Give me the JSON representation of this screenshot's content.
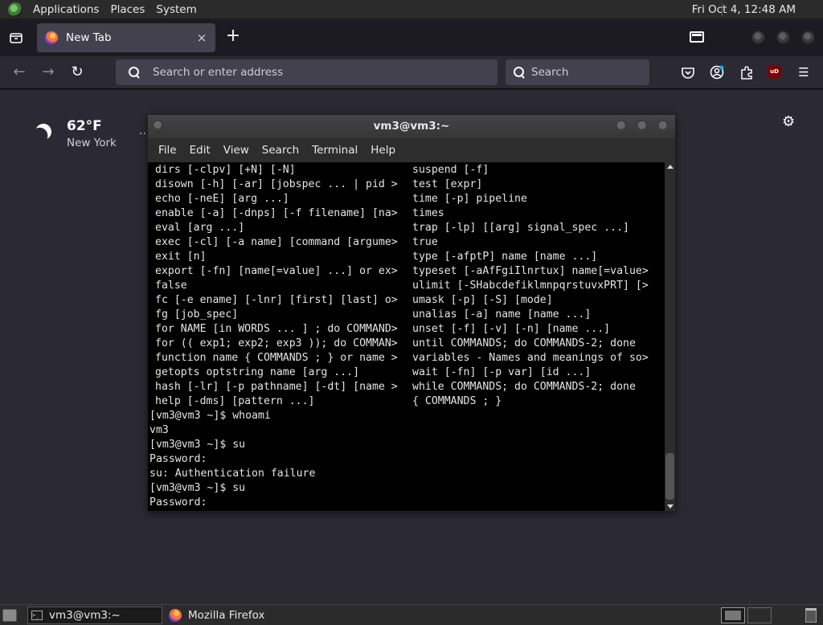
{
  "top_panel": {
    "menus": [
      "Applications",
      "Places",
      "System"
    ],
    "clock": "Fri Oct  4, 12:48 AM"
  },
  "browser": {
    "tab": {
      "title": "New Tab",
      "close": "×"
    },
    "new_tab_button": "+",
    "url_placeholder": "Search or enter address",
    "search_placeholder": "Search"
  },
  "newtab_page": {
    "weather": {
      "temperature": "62°F",
      "city": "New York",
      "more": ".."
    }
  },
  "terminal": {
    "title": "vm3@vm3:~",
    "menus": [
      "File",
      "Edit",
      "View",
      "Search",
      "Terminal",
      "Help"
    ],
    "help_left": [
      "dirs [-clpv] [+N] [-N]",
      "disown [-h] [-ar] [jobspec ... | pid >",
      "echo [-neE] [arg ...]",
      "enable [-a] [-dnps] [-f filename] [na>",
      "eval [arg ...]",
      "exec [-cl] [-a name] [command [argume>",
      "exit [n]",
      "export [-fn] [name[=value] ...] or ex>",
      "false",
      "fc [-e ename] [-lnr] [first] [last] o>",
      "fg [job_spec]",
      "for NAME [in WORDS ... ] ; do COMMAND>",
      "for (( exp1; exp2; exp3 )); do COMMAN>",
      "function name { COMMANDS ; } or name >",
      "getopts optstring name [arg ...]",
      "hash [-lr] [-p pathname] [-dt] [name >",
      "help [-dms] [pattern ...]"
    ],
    "help_right": [
      "suspend [-f]",
      "test [expr]",
      "time [-p] pipeline",
      "times",
      "trap [-lp] [[arg] signal_spec ...]",
      "true",
      "type [-afptP] name [name ...]",
      "typeset [-aAfFgiIlnrtux] name[=value>",
      "ulimit [-SHabcdefiklmnpqrstuvxPRT] [>",
      "umask [-p] [-S] [mode]",
      "unalias [-a] name [name ...]",
      "unset [-f] [-v] [-n] [name ...]",
      "until COMMANDS; do COMMANDS-2; done",
      "variables - Names and meanings of so>",
      "wait [-fn] [-p var] [id ...]",
      "while COMMANDS; do COMMANDS-2; done",
      "{ COMMANDS ; }"
    ],
    "session": [
      "[vm3@vm3 ~]$ whoami",
      "vm3",
      "[vm3@vm3 ~]$ su",
      "Password:",
      "su: Authentication failure",
      "[vm3@vm3 ~]$ su",
      "Password:"
    ]
  },
  "taskbar": {
    "tasks": [
      "vm3@vm3:~",
      "Mozilla Firefox"
    ]
  },
  "icons": {
    "distro_logo": "circle",
    "list_all_tabs": "tray",
    "back": "←",
    "forward": "→",
    "reload": "↻",
    "pocket": "pocket",
    "account": "account",
    "extensions": "puzzle",
    "ublock": "uD",
    "menu": "☰",
    "settings": "⚙",
    "terminal_icon": ">_"
  }
}
